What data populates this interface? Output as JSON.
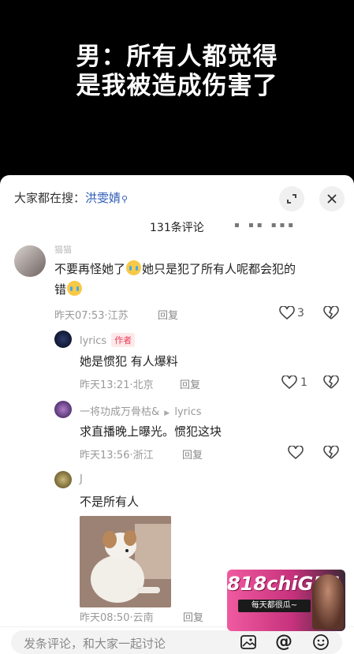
{
  "headline": [
    "男：所有人都觉得",
    "是我被造成伤害了"
  ],
  "search": {
    "prefix": "大家都在搜：",
    "term": "洪雯婧"
  },
  "comments_header": {
    "count_label": "131条评论"
  },
  "comments": [
    {
      "username": "猫猫",
      "text_line1_a": "不要再怪她了",
      "text_line1_b": "她只是犯了所有人呢都会犯的",
      "text_line2": "错",
      "meta": "昨天07:53·江苏",
      "reply_label": "回复",
      "likes": "3"
    },
    {
      "username": "lyrics",
      "author_tag": "作者",
      "text": "她是惯犯 有人爆料",
      "meta": "昨天13:21·北京",
      "reply_label": "回复",
      "likes": "1"
    },
    {
      "username": "一将功成万骨枯&",
      "reply_to": "lyrics",
      "text": "求直播晚上曝光。惯犯这块",
      "meta": "昨天13:56·浙江",
      "reply_label": "回复"
    },
    {
      "username": "J",
      "text": "不是所有人",
      "meta": "昨天08:50·云南",
      "reply_label": "回复"
    }
  ],
  "bottom_bar": {
    "placeholder": "发条评论，和大家一起讨论"
  },
  "watermark": {
    "brand": "818chiGUA",
    "tagline": "每天都很瓜~"
  },
  "icons": [
    "search-icon",
    "collapse-icon",
    "close-icon",
    "heart-icon",
    "broken-heart-icon",
    "image-icon",
    "at-icon",
    "emoji-icon"
  ],
  "colors": {
    "link": "#2f5db5",
    "author_tag": "#e8405a",
    "sheet": "#ffffff",
    "background": "#000000"
  }
}
